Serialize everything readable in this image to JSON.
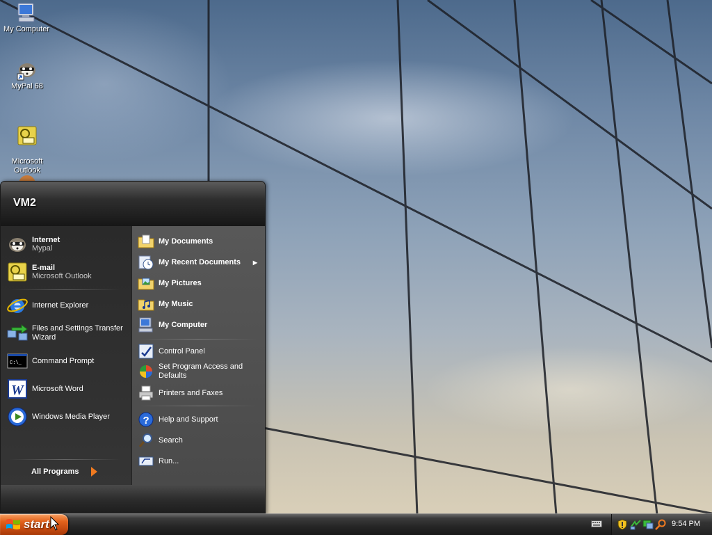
{
  "desktop": {
    "icons": [
      {
        "label": "My Computer",
        "icon": "computer-icon"
      },
      {
        "label": "MyPal 68",
        "icon": "raccoon-icon"
      },
      {
        "label": "Microsoft\nOutlook",
        "icon": "outlook-icon"
      }
    ]
  },
  "start_menu": {
    "user_name": "VM2",
    "pinned": [
      {
        "title": "Internet",
        "subtitle": "Mypal",
        "icon": "raccoon-icon"
      },
      {
        "title": "E-mail",
        "subtitle": "Microsoft Outlook",
        "icon": "outlook-icon"
      }
    ],
    "recent_programs": [
      {
        "label": "Internet Explorer",
        "icon": "ie-icon"
      },
      {
        "label": "Files and Settings Transfer Wizard",
        "icon": "transfer-wizard-icon"
      },
      {
        "label": "Command Prompt",
        "icon": "cmd-icon"
      },
      {
        "label": "Microsoft Word",
        "icon": "word-icon"
      },
      {
        "label": "Windows Media Player",
        "icon": "media-player-icon"
      }
    ],
    "all_programs_label": "All Programs",
    "places": [
      {
        "label": "My Documents",
        "icon": "documents-folder-icon"
      },
      {
        "label": "My Recent Documents",
        "icon": "recent-documents-icon"
      },
      {
        "label": "My Pictures",
        "icon": "pictures-folder-icon"
      },
      {
        "label": "My Music",
        "icon": "music-folder-icon"
      },
      {
        "label": "My Computer",
        "icon": "computer-icon"
      }
    ],
    "settings": [
      {
        "label": "Control Panel",
        "icon": "control-panel-icon"
      },
      {
        "label": "Set Program Access and Defaults",
        "icon": "program-defaults-icon"
      },
      {
        "label": "Printers and Faxes",
        "icon": "printer-icon"
      }
    ],
    "tools": [
      {
        "label": "Help and Support",
        "icon": "help-icon"
      },
      {
        "label": "Search",
        "icon": "search-icon"
      },
      {
        "label": "Run...",
        "icon": "run-icon"
      }
    ]
  },
  "taskbar": {
    "start_label": "start",
    "clock": "9:54 PM"
  },
  "colors": {
    "start_button": "#e2621c",
    "menu_dark": "#2a2a2a",
    "menu_light": "#585858"
  }
}
